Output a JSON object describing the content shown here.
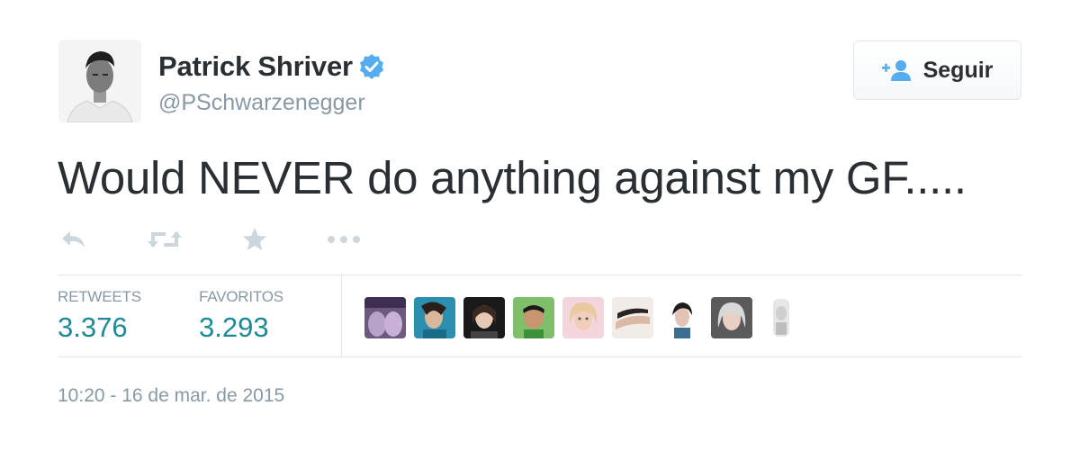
{
  "user": {
    "name": "Patrick Shriver",
    "handle": "@PSchwarzenegger",
    "verified": true
  },
  "follow_button": {
    "label": "Seguir",
    "icon": "follow-icon"
  },
  "tweet": {
    "text": "Would NEVER do anything against my GF....."
  },
  "actions": [
    {
      "name": "reply",
      "icon": "reply-icon"
    },
    {
      "name": "retweet",
      "icon": "retweet-icon"
    },
    {
      "name": "favorite",
      "icon": "star-icon"
    },
    {
      "name": "more",
      "icon": "more-icon"
    }
  ],
  "stats": {
    "retweets_label": "RETWEETS",
    "retweets_value": "3.376",
    "favorites_label": "FAVORITOS",
    "favorites_value": "3.293"
  },
  "favoriter_avatars": [
    "avatar-1",
    "avatar-2",
    "avatar-3",
    "avatar-4",
    "avatar-5",
    "avatar-6",
    "avatar-7",
    "avatar-8",
    "avatar-9"
  ],
  "timestamp": "10:20 - 16 de mar. de 2015",
  "colors": {
    "text": "#292f33",
    "muted": "#8899a6",
    "stat_value": "#1d8a96",
    "verified": "#55acee",
    "action_icon": "#ccd6dd"
  }
}
